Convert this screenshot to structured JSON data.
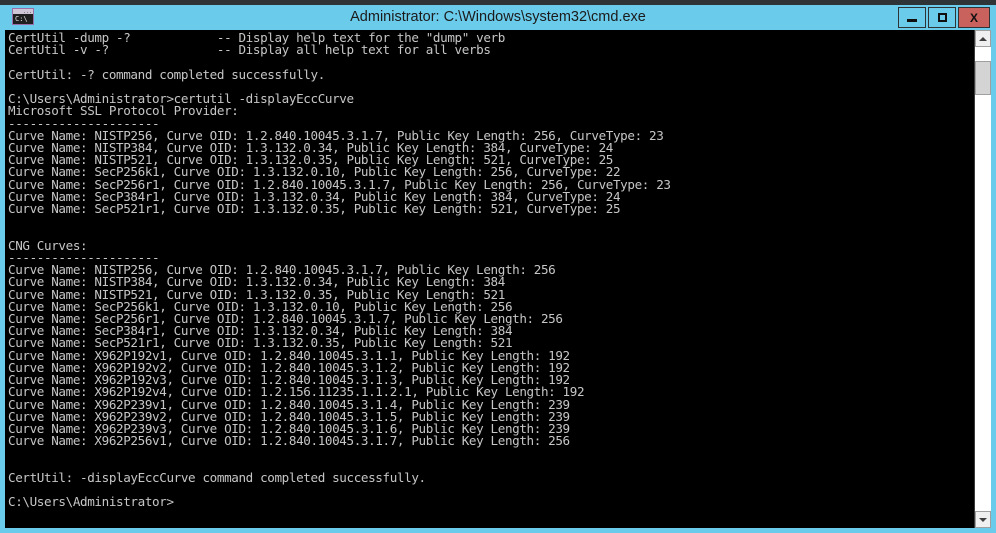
{
  "window": {
    "title": "Administrator: C:\\Windows\\system32\\cmd.exe",
    "icon_prompt": "C:\\",
    "icon_dots": "...",
    "titlebar_color": "#6bcbeb",
    "close_button_color": "#c9615c",
    "console_background": "#000000",
    "console_foreground": "#c6c6c6"
  },
  "controls": {
    "minimize_label": "Minimize",
    "maximize_label": "Maximize",
    "close_label": "X"
  },
  "scrollbar": {
    "up_label": "Scroll up",
    "down_label": "Scroll down",
    "thumb_label": "Scroll thumb"
  },
  "console": {
    "lines": [
      "CertUtil -dump -?            -- Display help text for the \"dump\" verb",
      "CertUtil -v -?               -- Display all help text for all verbs",
      "",
      "CertUtil: -? command completed successfully.",
      "",
      "C:\\Users\\Administrator>certutil -displayEccCurve",
      "Microsoft SSL Protocol Provider:",
      "---------------------",
      "Curve Name: NISTP256, Curve OID: 1.2.840.10045.3.1.7, Public Key Length: 256, CurveType: 23",
      "Curve Name: NISTP384, Curve OID: 1.3.132.0.34, Public Key Length: 384, CurveType: 24",
      "Curve Name: NISTP521, Curve OID: 1.3.132.0.35, Public Key Length: 521, CurveType: 25",
      "Curve Name: SecP256k1, Curve OID: 1.3.132.0.10, Public Key Length: 256, CurveType: 22",
      "Curve Name: SecP256r1, Curve OID: 1.2.840.10045.3.1.7, Public Key Length: 256, CurveType: 23",
      "Curve Name: SecP384r1, Curve OID: 1.3.132.0.34, Public Key Length: 384, CurveType: 24",
      "Curve Name: SecP521r1, Curve OID: 1.3.132.0.35, Public Key Length: 521, CurveType: 25",
      "",
      "",
      "CNG Curves:",
      "---------------------",
      "Curve Name: NISTP256, Curve OID: 1.2.840.10045.3.1.7, Public Key Length: 256",
      "Curve Name: NISTP384, Curve OID: 1.3.132.0.34, Public Key Length: 384",
      "Curve Name: NISTP521, Curve OID: 1.3.132.0.35, Public Key Length: 521",
      "Curve Name: SecP256k1, Curve OID: 1.3.132.0.10, Public Key Length: 256",
      "Curve Name: SecP256r1, Curve OID: 1.2.840.10045.3.1.7, Public Key Length: 256",
      "Curve Name: SecP384r1, Curve OID: 1.3.132.0.34, Public Key Length: 384",
      "Curve Name: SecP521r1, Curve OID: 1.3.132.0.35, Public Key Length: 521",
      "Curve Name: X962P192v1, Curve OID: 1.2.840.10045.3.1.1, Public Key Length: 192",
      "Curve Name: X962P192v2, Curve OID: 1.2.840.10045.3.1.2, Public Key Length: 192",
      "Curve Name: X962P192v3, Curve OID: 1.2.840.10045.3.1.3, Public Key Length: 192",
      "Curve Name: X962P192v4, Curve OID: 1.2.156.11235.1.1.2.1, Public Key Length: 192",
      "Curve Name: X962P239v1, Curve OID: 1.2.840.10045.3.1.4, Public Key Length: 239",
      "Curve Name: X962P239v2, Curve OID: 1.2.840.10045.3.1.5, Public Key Length: 239",
      "Curve Name: X962P239v3, Curve OID: 1.2.840.10045.3.1.6, Public Key Length: 239",
      "Curve Name: X962P256v1, Curve OID: 1.2.840.10045.3.1.7, Public Key Length: 256",
      "",
      "",
      "CertUtil: -displayEccCurve command completed successfully.",
      "",
      "C:\\Users\\Administrator>"
    ]
  }
}
